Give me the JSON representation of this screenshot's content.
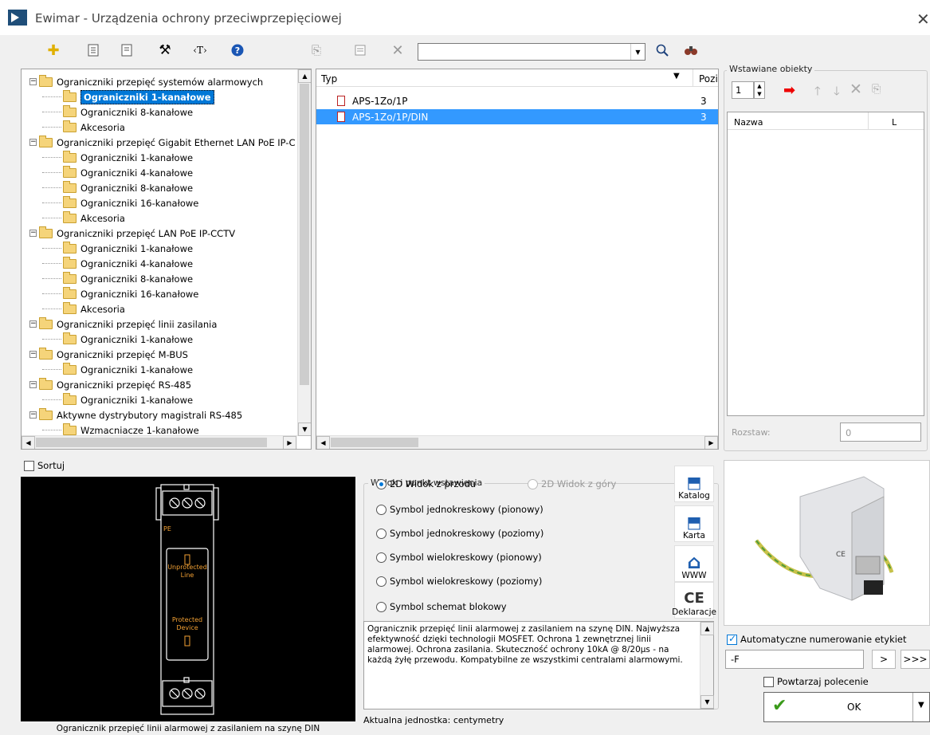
{
  "window": {
    "title": "Ewimar - Urządzenia ochrony przeciwprzepięciowej"
  },
  "toolbar": {
    "search_value": ""
  },
  "tree": {
    "items": [
      {
        "label": "Ograniczniki przepięć systemów alarmowych",
        "level": 0,
        "expander": "−"
      },
      {
        "label": "Ograniczniki 1-kanałowe",
        "level": 1,
        "selected": true
      },
      {
        "label": "Ograniczniki 8-kanałowe",
        "level": 1
      },
      {
        "label": "Akcesoria",
        "level": 1
      },
      {
        "label": "Ograniczniki przepięć Gigabit Ethernet LAN PoE IP-C",
        "level": 0,
        "expander": "−"
      },
      {
        "label": "Ograniczniki 1-kanałowe",
        "level": 1
      },
      {
        "label": "Ograniczniki 4-kanałowe",
        "level": 1
      },
      {
        "label": "Ograniczniki 8-kanałowe",
        "level": 1
      },
      {
        "label": "Ograniczniki 16-kanałowe",
        "level": 1
      },
      {
        "label": "Akcesoria",
        "level": 1
      },
      {
        "label": "Ograniczniki przepięć LAN PoE IP-CCTV",
        "level": 0,
        "expander": "−"
      },
      {
        "label": "Ograniczniki 1-kanałowe",
        "level": 1
      },
      {
        "label": "Ograniczniki 4-kanałowe",
        "level": 1
      },
      {
        "label": "Ograniczniki 8-kanałowe",
        "level": 1
      },
      {
        "label": "Ograniczniki 16-kanałowe",
        "level": 1
      },
      {
        "label": "Akcesoria",
        "level": 1
      },
      {
        "label": "Ograniczniki przepięć linii zasilania",
        "level": 0,
        "expander": "−"
      },
      {
        "label": "Ograniczniki 1-kanałowe",
        "level": 1
      },
      {
        "label": "Ograniczniki przepięć M-BUS",
        "level": 0,
        "expander": "−"
      },
      {
        "label": "Ograniczniki 1-kanałowe",
        "level": 1
      },
      {
        "label": "Ograniczniki przepięć RS-485",
        "level": 0,
        "expander": "−"
      },
      {
        "label": "Ograniczniki 1-kanałowe",
        "level": 1
      },
      {
        "label": "Aktywne dystrybutory magistrali RS-485",
        "level": 0,
        "expander": "−"
      },
      {
        "label": "Wzmacniacze 1-kanałowe",
        "level": 1
      }
    ]
  },
  "list": {
    "col_type": "Typ",
    "col_pos": "Pozi",
    "rows": [
      {
        "type": "APS-1Zo/1P",
        "pos": "3",
        "selected": false
      },
      {
        "type": "APS-1Zo/1P/DIN",
        "pos": "3",
        "selected": true
      }
    ]
  },
  "inserted": {
    "title": "Wstawiane obiekty",
    "quantity": "1",
    "col_name": "Nazwa",
    "col_l": "L",
    "rozstaw_label": "Rozstaw:",
    "rozstaw_value": "0"
  },
  "sort_label": "Sortuj",
  "preview_caption": "Ogranicznik przepięć linii alarmowej z zasilaniem na szynę DIN",
  "preview_drawing": {
    "pe_label": "PE",
    "unprotected": "Unprotected\nLine",
    "protected": "Protected\nDevice"
  },
  "view": {
    "title": "Widok i punkt wstawienia",
    "options": [
      {
        "label": "2D Widok z przodu",
        "checked": true,
        "disabled": false
      },
      {
        "label": "2D Widok z góry",
        "checked": false,
        "disabled": true
      },
      {
        "label": "Symbol jednokreskowy (pionowy)",
        "checked": false,
        "disabled": false
      },
      {
        "label": "Symbol jednokreskowy (poziomy)",
        "checked": false,
        "disabled": false
      },
      {
        "label": "Symbol wielokreskowy (pionowy)",
        "checked": false,
        "disabled": false
      },
      {
        "label": "Symbol wielokreskowy (poziomy)",
        "checked": false,
        "disabled": false
      },
      {
        "label": "Symbol schemat blokowy",
        "checked": false,
        "disabled": false
      }
    ],
    "buttons": [
      {
        "label": "Katalog",
        "icon": "pdf-icon"
      },
      {
        "label": "Karta",
        "icon": "pdf-icon"
      },
      {
        "label": "WWW",
        "icon": "home-icon"
      },
      {
        "label": "Deklaracje",
        "icon": "ce-icon"
      }
    ]
  },
  "description": "Ogranicznik przepięć linii alarmowej z zasilaniem na szynę DIN. Najwyższa efektywność dzięki technologii MOSFET. Ochrona 1 zewnętrznej linii alarmowej. Ochrona zasilania. Skuteczność ochrony 10kA @ 8/20µs - na każdą żyłę przewodu. Kompatybilne ze wszystkimi centralami alarmowymi.",
  "unit_label": "Aktualna jednostka: centymetry",
  "auto_numbering": {
    "label": "Automatyczne numerowanie etykiet",
    "checked": true,
    "value": "-F",
    "next": ">",
    "last": ">>>"
  },
  "repeat": {
    "label": "Powtarzaj polecenie",
    "checked": false
  },
  "ok_label": "OK",
  "colors": {
    "selection": "#0078d7",
    "list_selection": "#3399ff",
    "title_accent": "#1f4e79"
  }
}
